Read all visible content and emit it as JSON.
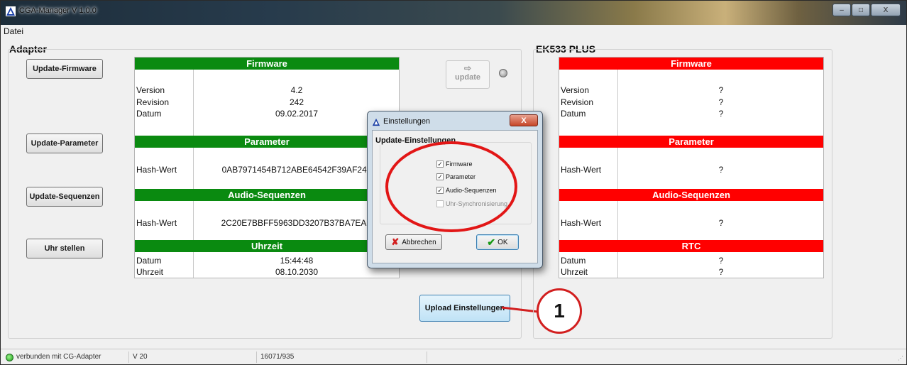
{
  "window": {
    "title": "CGA-Manager V 1.0.0",
    "controls": [
      "–",
      "□",
      "X"
    ]
  },
  "menu": {
    "file": "Datei"
  },
  "adapter": {
    "title": "Adapter",
    "buttons": {
      "firmware": "Update-Firmware",
      "parameter": "Update-Parameter",
      "sequences": "Update-Sequenzen",
      "clock": "Uhr stellen"
    },
    "firmware": {
      "header": "Firmware",
      "version_label": "Version",
      "version": "4.2",
      "revision_label": "Revision",
      "revision": "242",
      "date_label": "Datum",
      "date": "09.02.2017"
    },
    "parameter": {
      "header": "Parameter",
      "hash_label": "Hash-Wert",
      "hash": "0AB7971454B712ABE64542F39AF240"
    },
    "audio": {
      "header": "Audio-Sequenzen",
      "hash_label": "Hash-Wert",
      "hash": "2C20E7BBFF5963DD3207B37BA7EAE"
    },
    "clock": {
      "header": "Uhrzeit",
      "date_label": "Datum",
      "date": "15:44:48",
      "time_label": "Uhrzeit",
      "time": "08.10.2030"
    }
  },
  "middle": {
    "update_arrow": "⇨",
    "update_label": "update",
    "upload_label": "Upload Einstellungen",
    "callout": "1"
  },
  "device": {
    "title": "EK533 PLUS",
    "firmware": {
      "header": "Firmware",
      "version_label": "Version",
      "version": "?",
      "revision_label": "Revision",
      "revision": "?",
      "date_label": "Datum",
      "date": "?"
    },
    "parameter": {
      "header": "Parameter",
      "hash_label": "Hash-Wert",
      "hash": "?"
    },
    "audio": {
      "header": "Audio-Sequenzen",
      "hash_label": "Hash-Wert",
      "hash": "?"
    },
    "rtc": {
      "header": "RTC",
      "date_label": "Datum",
      "date": "?",
      "time_label": "Uhrzeit",
      "time": "?"
    }
  },
  "dialog": {
    "title": "Einstellungen",
    "close": "X",
    "group_title": "Update-Einstellungen",
    "options": [
      {
        "label": "Firmware",
        "checked": true
      },
      {
        "label": "Parameter",
        "checked": true
      },
      {
        "label": "Audio-Sequenzen",
        "checked": true
      },
      {
        "label": "Uhr-Synchronisierung",
        "checked": false
      }
    ],
    "cancel": "Abbrechen",
    "ok": "OK"
  },
  "status": {
    "connection": "verbunden mit CG-Adapter",
    "version": "V 20",
    "counter": "16071/935"
  },
  "colors": {
    "ok_header": "#0a8a10",
    "error_header": "#ff0000",
    "annotation": "#e21616"
  }
}
